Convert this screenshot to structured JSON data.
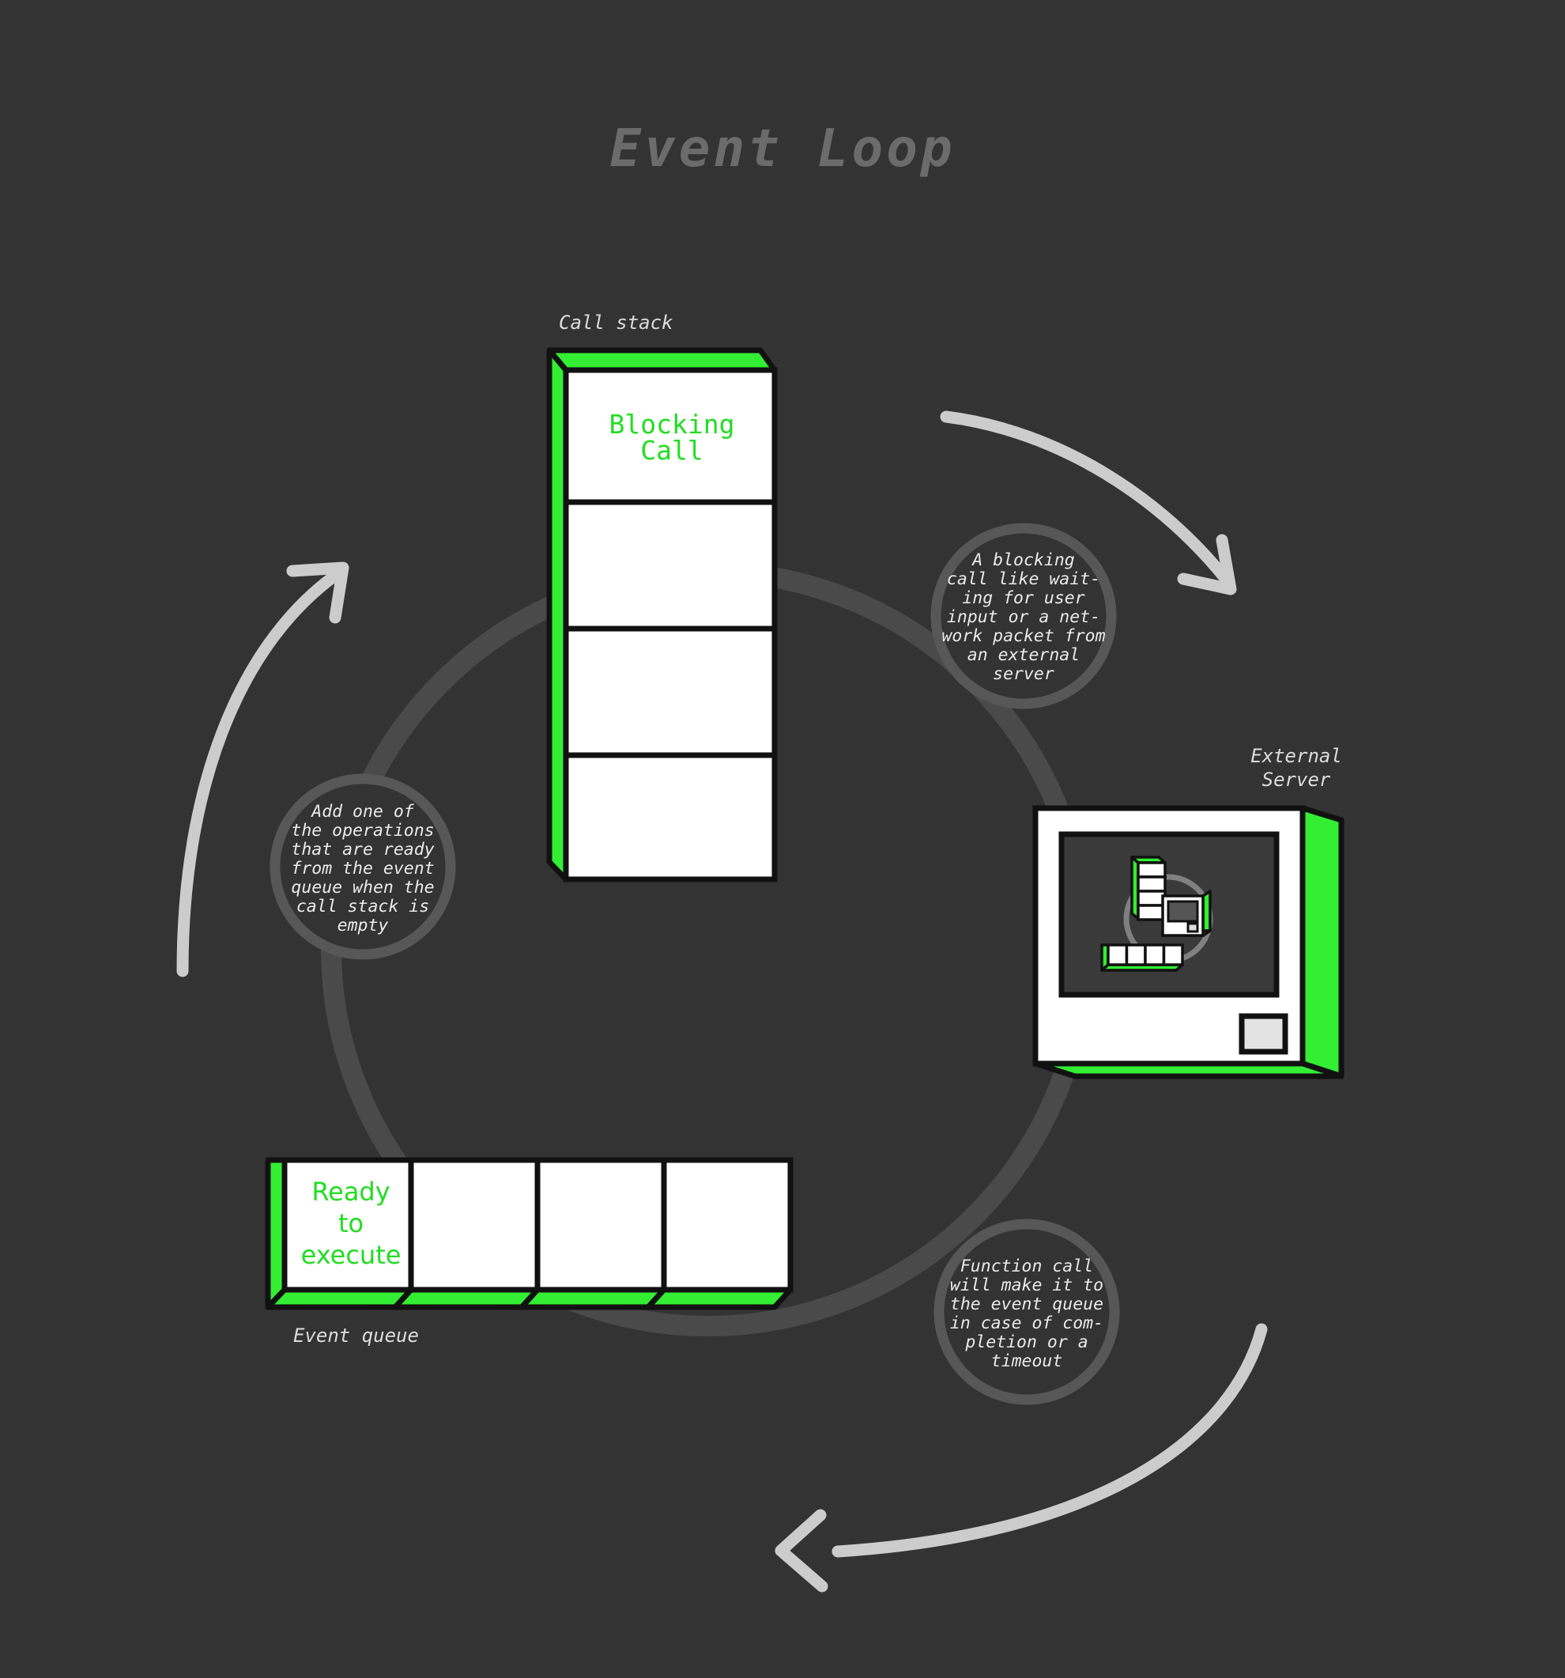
{
  "page": {
    "title": "Event Loop",
    "background_color": "#333333"
  },
  "colors": {
    "background": "#333333",
    "accent_green": "#33ee33",
    "loop_ring": "#4a4a4a",
    "bubble_stroke": "#575757",
    "arrow": "#cccccc",
    "title_text": "#6b6b6b",
    "label_text": "#dcdcdc",
    "box_face": "#ffffff",
    "outline": "#111111",
    "screen": "#3a3a3a"
  },
  "call_stack": {
    "label": "Call stack",
    "cells": [
      {
        "text_line1": "Blocking",
        "text_line2": "Call"
      },
      {
        "text_line1": "",
        "text_line2": ""
      },
      {
        "text_line1": "",
        "text_line2": ""
      },
      {
        "text_line1": "",
        "text_line2": ""
      }
    ]
  },
  "event_queue": {
    "label": "Event queue",
    "cells": [
      {
        "line1": "Ready",
        "line2": "to",
        "line3": "execute"
      },
      {
        "line1": "",
        "line2": "",
        "line3": ""
      },
      {
        "line1": "",
        "line2": "",
        "line3": ""
      },
      {
        "line1": "",
        "line2": "",
        "line3": ""
      }
    ]
  },
  "external_server": {
    "label_line1": "External",
    "label_line2": "Server"
  },
  "bubbles": [
    {
      "id": "blocking-call-note",
      "lines": [
        "A blocking",
        "call like wait-",
        "ing for user",
        "input or a net-",
        "work packet from",
        "an external",
        "server"
      ]
    },
    {
      "id": "event-queue-note",
      "lines": [
        "Add one of",
        "the operations",
        "that are ready",
        "from the event",
        "queue when the",
        "call stack is",
        "empty"
      ]
    },
    {
      "id": "completion-note",
      "lines": [
        "Function call",
        "will make it to",
        "the event queue",
        "in case of com-",
        "pletion or a",
        "timeout"
      ]
    }
  ]
}
